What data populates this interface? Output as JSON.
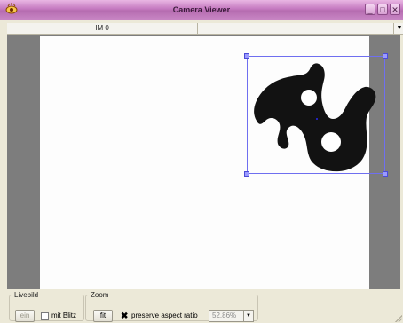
{
  "window": {
    "title": "Camera Viewer",
    "icon": "eye-icon",
    "controls": {
      "minimize": "_",
      "maximize": "□",
      "close": "✕"
    }
  },
  "tabs": [
    {
      "label": "IM 0"
    },
    {
      "label": ""
    }
  ],
  "tab_dropdown_icon": "chevron-down-icon",
  "viewer": {
    "background_color": "#7d7d7d",
    "roi_color": "#6f6ff0"
  },
  "livebild": {
    "legend": "Livebild",
    "ein_label": "ein",
    "blitz_label": "mit Blitz",
    "blitz_checked": false
  },
  "zoom": {
    "legend": "Zoom",
    "fit_label": "fit",
    "aspect_label": "preserve aspect ratio",
    "aspect_checked": true,
    "value": "52.86%"
  }
}
